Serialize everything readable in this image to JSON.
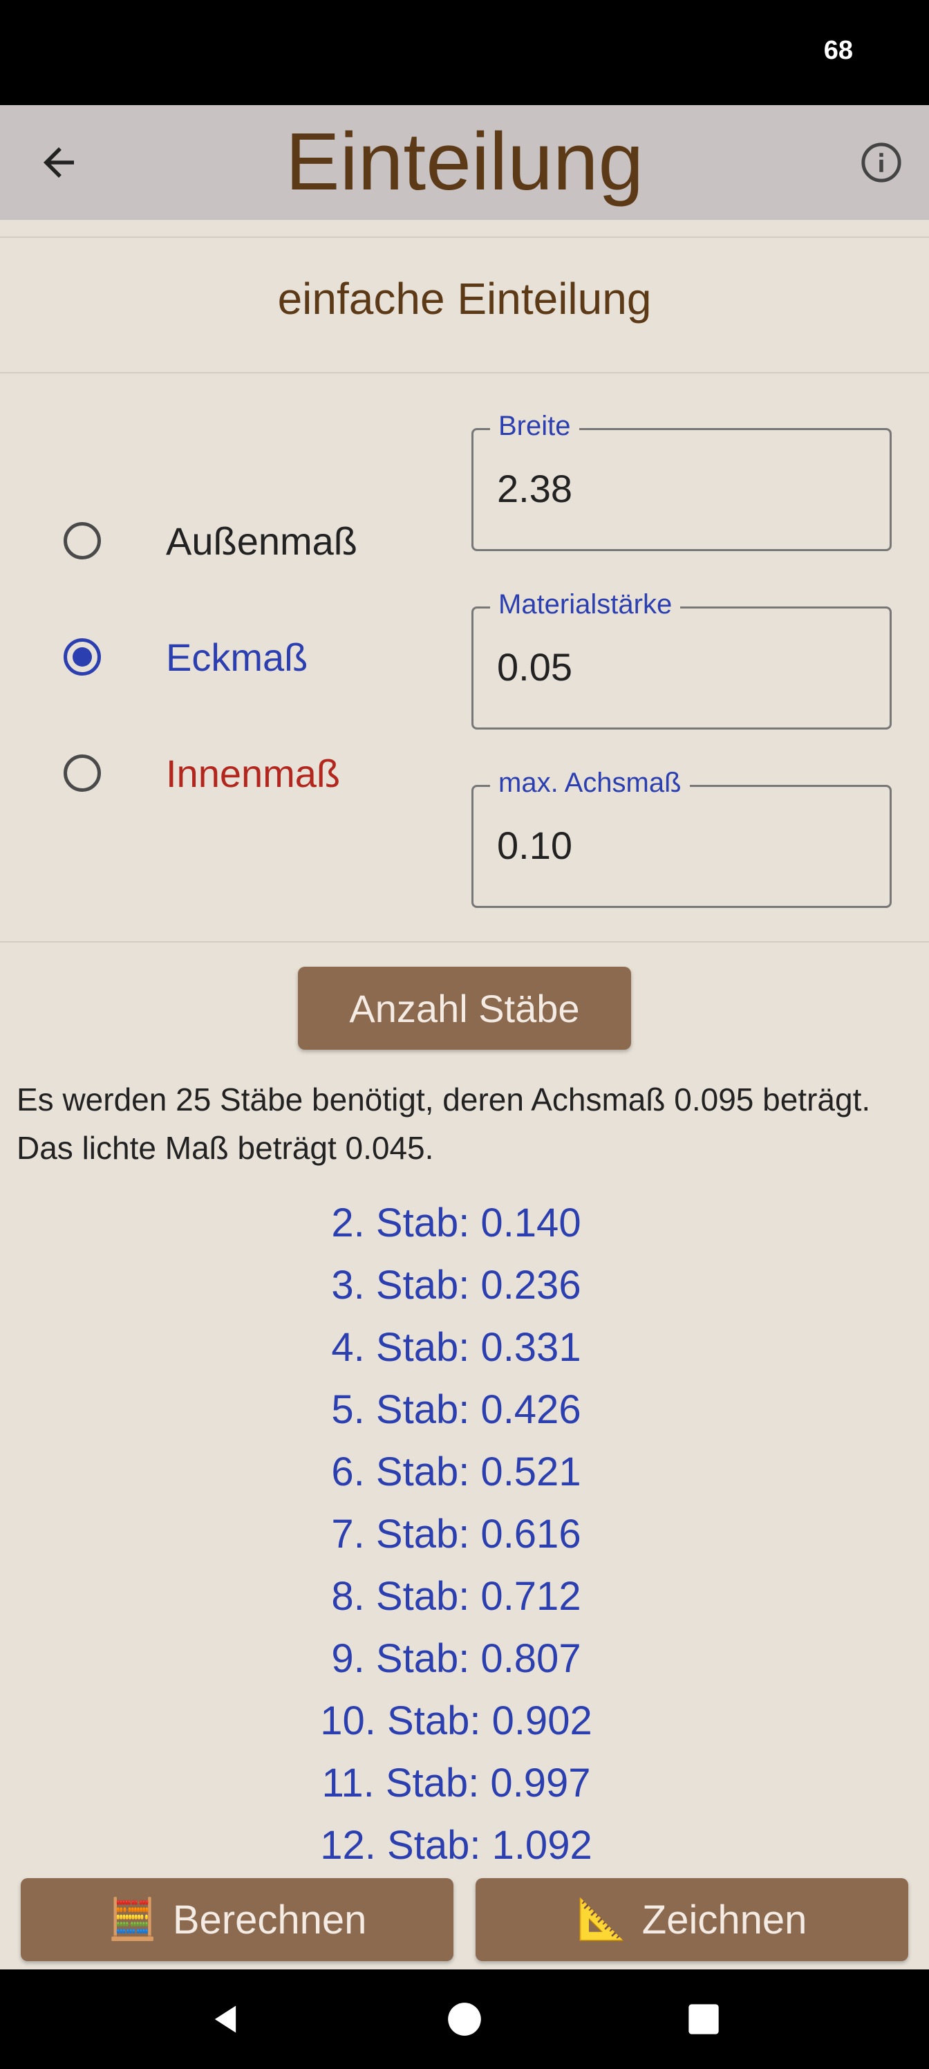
{
  "status": {
    "battery": "68"
  },
  "app_bar": {
    "title": "Einteilung",
    "back_icon": "arrow-left-icon",
    "info_icon": "info-icon"
  },
  "subtitle": "einfache Einteilung",
  "mode_options": [
    {
      "label": "Außenmaß",
      "selected": false,
      "color": "#222222"
    },
    {
      "label": "Eckmaß",
      "selected": true,
      "color": "#2b3fb0"
    },
    {
      "label": "Innenmaß",
      "selected": false,
      "color": "#b3261e"
    }
  ],
  "fields": {
    "width": {
      "label": "Breite",
      "value": "2.38"
    },
    "material": {
      "label": "Materialstärke",
      "value": "0.05"
    },
    "max_axis": {
      "label": "max. Achsmaß",
      "value": "0.10"
    }
  },
  "count_button": "Anzahl Stäbe",
  "result_text": "Es werden 25 Stäbe benötigt, deren Achsmaß 0.095 beträgt. Das lichte Maß beträgt 0.045.",
  "rods": [
    "2. Stab: 0.140",
    "3. Stab: 0.236",
    "4. Stab: 0.331",
    "5. Stab: 0.426",
    "6. Stab: 0.521",
    "7. Stab: 0.616",
    "8. Stab: 0.712",
    "9. Stab: 0.807",
    "10. Stab: 0.902",
    "11. Stab: 0.997",
    "12. Stab: 1.092"
  ],
  "bottom_buttons": {
    "calculate": {
      "icon": "🧮",
      "label": "Berechnen"
    },
    "draw": {
      "icon": "📐",
      "label": "Zeichnen"
    }
  },
  "colors": {
    "accent": "#2b3fb0",
    "brand_brown": "#5c3a17",
    "button": "#8b6a4f",
    "background": "#e7e1d7",
    "error_red": "#b3261e"
  }
}
